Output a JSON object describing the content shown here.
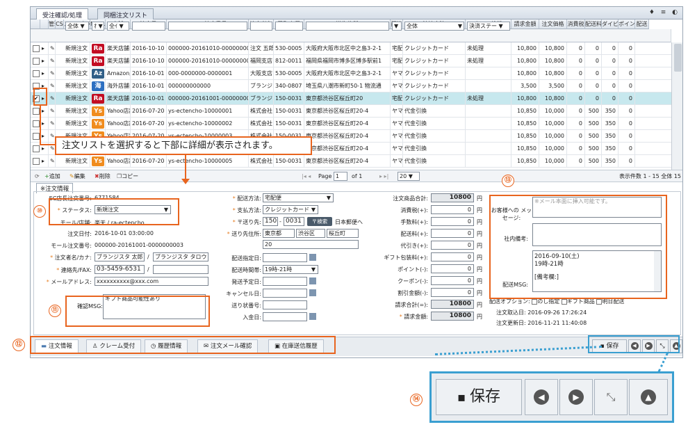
{
  "tabs": [
    "受注確認/処理",
    "同梱注文リスト"
  ],
  "tab_icons": "♦ ≡ ◐",
  "grid": {
    "headers": [
      "",
      "",
      "管理",
      "CS",
      "ステータス",
      "MALL",
      "店舗",
      "注文日",
      "モール注文番号",
      "注文者名",
      "受取人郵",
      "送先住所",
      "配送",
      "決済方法",
      "カード状態",
      "請求金額",
      "注文価格",
      "消費税",
      "配送料",
      "ダイビ",
      "ポイン",
      "配送"
    ],
    "filters": {
      "status": "全体 ▼",
      "mall": "ｵ ▼",
      "shop": "全ｲ ▼",
      "payment": "全体",
      "card": "決済ステー ▼",
      "delivery": "▼"
    },
    "rows": [
      {
        "status": "新規注文",
        "mall": "Ra",
        "shop": "楽天店舗",
        "date": "2016-10-10",
        "order_no": "000000-20161010-0000000003",
        "buyer": "注文 五郎",
        "zip": "530-0005",
        "addr": "大阪府大阪市北区中之島3-2-1",
        "ship": "宅配便",
        "pay": "クレジットカード",
        "card": "未処理",
        "bill": "10,800",
        "price": "10,800",
        "tax": "0",
        "fee": "0",
        "dai": "0",
        "pt": "0"
      },
      {
        "status": "新規注文",
        "mall": "Ra",
        "shop": "楽天店舗",
        "date": "2016-10-10",
        "order_no": "000000-20161010-0000000001",
        "buyer": "福岡支店",
        "zip": "812-0011",
        "addr": "福岡県福岡市博多区博多駅前1",
        "ship": "宅配便",
        "pay": "クレジットカード",
        "card": "未処理",
        "bill": "10,800",
        "price": "10,800",
        "tax": "0",
        "fee": "0",
        "dai": "0",
        "pt": "0"
      },
      {
        "status": "新規注文",
        "mall": "Az",
        "shop": "Amazon店舗",
        "date": "2016-10-01",
        "order_no": "000-0000000-0000001",
        "buyer": "大阪支店",
        "zip": "530-0005",
        "addr": "大阪府大阪市北区中之島3-2-1",
        "ship": "ヤマト",
        "pay": "クレジットカード",
        "card": "",
        "bill": "10,800",
        "price": "10,800",
        "tax": "0",
        "fee": "0",
        "dai": "0",
        "pt": "0"
      },
      {
        "status": "新規注文",
        "mall": "海",
        "shop": "海外店舗",
        "date": "2016-10-01",
        "order_no": "000000000000",
        "buyer": "ブランジスタ",
        "zip": "340-0807",
        "addr": "埼玉県八潮市新町50-1 物流通",
        "ship": "ヤマト",
        "pay": "クレジットカード",
        "card": "",
        "bill": "3,500",
        "price": "3,500",
        "tax": "0",
        "fee": "0",
        "dai": "0",
        "pt": "0"
      },
      {
        "status": "新規注文",
        "mall": "Ra",
        "shop": "楽天店舗",
        "date": "2016-10-01",
        "order_no": "000000-20161001-0000000003",
        "buyer": "ブランジスタ",
        "zip": "150-0031",
        "addr": "東京都渋谷区桜丘町20",
        "ship": "宅配便",
        "pay": "クレジットカード",
        "card": "未処理",
        "bill": "10,800",
        "price": "10,800",
        "tax": "0",
        "fee": "0",
        "dai": "0",
        "pt": "0"
      },
      {
        "status": "新規注文",
        "mall": "Ys",
        "shop": "Yahoo店舗",
        "date": "2016-07-20",
        "order_no": "ys-ectencho-10000001",
        "buyer": "株式会社 ブ",
        "zip": "150-0031",
        "addr": "東京都渋谷区桜丘町20-4",
        "ship": "ヤマト",
        "pay": "代金引換",
        "card": "",
        "bill": "10,850",
        "price": "10,000",
        "tax": "0",
        "fee": "500",
        "dai": "350",
        "pt": "0"
      },
      {
        "status": "新規注文",
        "mall": "Ys",
        "shop": "Yahoo店舗",
        "date": "2016-07-20",
        "order_no": "ys-ectencho-10000002",
        "buyer": "株式会社 ブ",
        "zip": "150-0031",
        "addr": "東京都渋谷区桜丘町20-4",
        "ship": "ヤマト",
        "pay": "代金引換",
        "card": "",
        "bill": "10,850",
        "price": "10,000",
        "tax": "0",
        "fee": "500",
        "dai": "350",
        "pt": "0"
      },
      {
        "status": "新規注文",
        "mall": "Ys",
        "shop": "Yahoo店舗",
        "date": "2016-07-20",
        "order_no": "ys-ectencho-10000003",
        "buyer": "株式会社 ブ",
        "zip": "150-0031",
        "addr": "東京都渋谷区桜丘町20-4",
        "ship": "ヤマト",
        "pay": "代金引換",
        "card": "",
        "bill": "10,850",
        "price": "10,000",
        "tax": "0",
        "fee": "500",
        "dai": "350",
        "pt": "0"
      },
      {
        "status": "",
        "mall": "",
        "shop": "",
        "date": "",
        "order_no": "",
        "buyer": "",
        "zip": "150-0031",
        "addr": "東京都渋谷区桜丘町20-4",
        "ship": "ヤマト",
        "pay": "代金引換",
        "card": "",
        "bill": "10,850",
        "price": "10,000",
        "tax": "0",
        "fee": "500",
        "dai": "350",
        "pt": "0"
      },
      {
        "status": "新規注文",
        "mall": "Ys",
        "shop": "Yahoo店舗",
        "date": "2016-07-20",
        "order_no": "ys-ectencho-10000005",
        "buyer": "株式会社 ブ",
        "zip": "150-0031",
        "addr": "東京都渋谷区桜丘町20-4",
        "ship": "ヤマト",
        "pay": "代金引換",
        "card": "",
        "bill": "10,850",
        "price": "10,000",
        "tax": "0",
        "fee": "500",
        "dai": "350",
        "pt": "0"
      }
    ]
  },
  "gridbar": {
    "add": "追加",
    "edit": "編集",
    "delete": "削除",
    "copy": "コピー",
    "page_label": "Page",
    "page_value": "1",
    "of": "of 1",
    "per_page": "20",
    "count_text": "表示件数 1 - 15 全体 15"
  },
  "callout": "注文リストを選択すると下部に詳細が表示されます。",
  "detail": {
    "section_title": "※注文情報",
    "ec_no_label": "EC店長注文番号:",
    "ec_no": "6771584",
    "status_label": "ステータス:",
    "status_value": "新規注文",
    "mall_label": "モール/店舗:",
    "mall_value": "楽天 / ra-ectencho",
    "date_label": "注文日付:",
    "date_value": "2016-10-01 03:00:00",
    "mall_no_label": "モール注文番号:",
    "mall_no_value": "000000-20161001-0000000003",
    "name_label": "注文者名/カナ:",
    "name_value": "ブランジスタ 太郎",
    "kana_value": "ブランジスタ タロウ",
    "tel_label": "連絡先/FAX:",
    "tel_value": "03-5459-6531",
    "mail_label": "メールアドレス:",
    "mail_value": "xxxxxxxxxx@xxx.com",
    "confirm_label": "確認MSG:",
    "confirm_value": "ギフト商品可能性あり",
    "ship_method_label": "配送方法:",
    "ship_method_value": "宅配便",
    "pay_label": "支払方法:",
    "pay_value": "クレジットカード",
    "zip_label": "〒送り先:",
    "zip1": "150",
    "zip2": "0031",
    "zip_btn": "〒検索",
    "post_label": "日本郵便へ",
    "addr_label": "送り先住所:",
    "addr1": "東京都",
    "addr2": "渋谷区",
    "addr3": "桜丘町",
    "addr4": "20",
    "ship_date_label": "配送指定日:",
    "ship_time_label": "配送時間帯:",
    "ship_time_value": "19時-21時",
    "plan_label": "発送予定日:",
    "cancel_label": "キャンセル日:",
    "slip_label": "送り状番号:",
    "pay_date_label": "入金日:",
    "sum": [
      {
        "label": "注文商品合計:",
        "value": "10800"
      },
      {
        "label": "消費税(+):",
        "value": "0"
      },
      {
        "label": "手数料(+):",
        "value": "0"
      },
      {
        "label": "配送料(+):",
        "value": "0"
      },
      {
        "label": "代引き(+):",
        "value": "0"
      },
      {
        "label": "ギフト包装料(+):",
        "value": "0"
      },
      {
        "label": "ポイント(-):",
        "value": "0"
      },
      {
        "label": "クーポン(-):",
        "value": "0"
      },
      {
        "label": "割引金額(-):",
        "value": "0"
      },
      {
        "label": "請求合計(=):",
        "value": "10800"
      },
      {
        "label": "請求金額:",
        "value": "10800"
      }
    ],
    "yen": "円",
    "msg_label": "お客様への メッセージ:",
    "msg_placeholder": "※メール本面に挿入可能です。",
    "memo_label": "社内備考:",
    "delivery_msg_label": "配送MSG:",
    "delivery_msg_l1": "2016-09-10(土)",
    "delivery_msg_l2": "19時-21時",
    "delivery_msg_l3": "[備考欄:]",
    "option_label": "配送オプション:",
    "option_1": "のし指定",
    "option_2": "ギフト商品",
    "option_3": "明日配送",
    "fetched_label": "注文取込日:",
    "fetched_value": "2016-09-26 17:26:24",
    "updated_label": "注文更新日:",
    "updated_value": "2016-11-21 11:40:08"
  },
  "bottom_tabs": [
    "注文情報",
    "クレーム受付",
    "履歴情報",
    "注文メール確認",
    "在庫送信履歴"
  ],
  "save_label": "保存",
  "zoom_save_label": "保存",
  "annotations": {
    "n10": "⑩",
    "n11": "⑪",
    "n12": "⑫",
    "n13": "⑬",
    "n14": "⑭"
  },
  "colors": {
    "accent": "#e8641e",
    "selected_row": "#c7e8ee",
    "zoom_border": "#3a9fd1"
  }
}
